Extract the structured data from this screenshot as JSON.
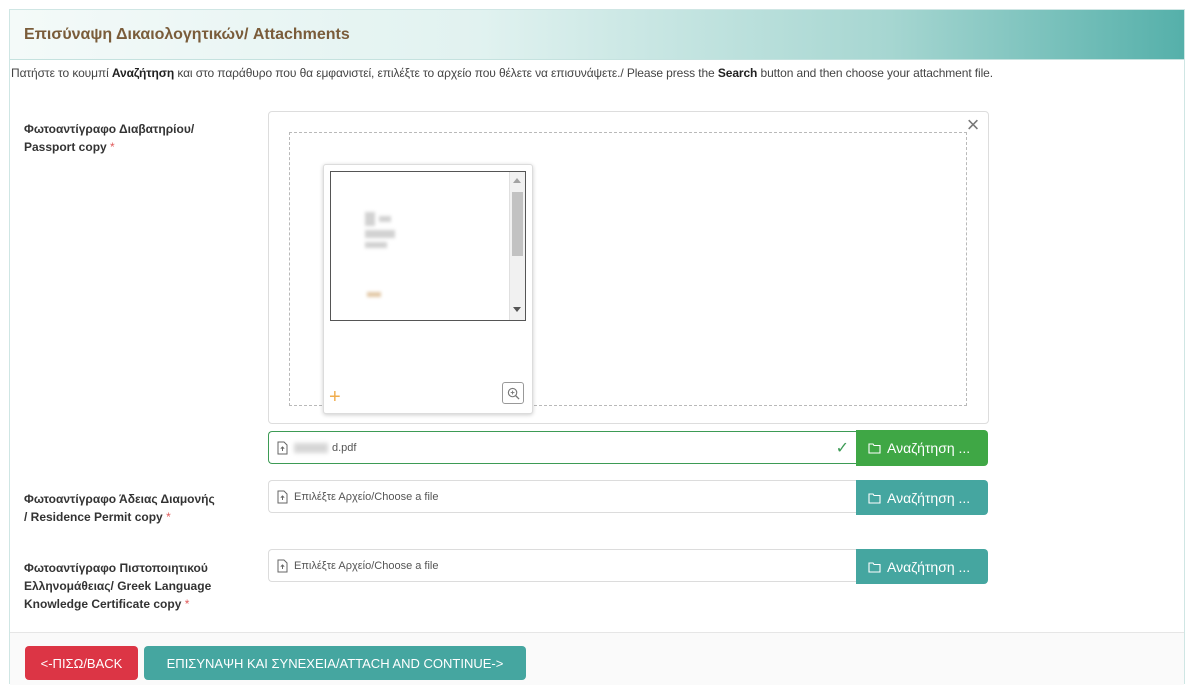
{
  "panel": {
    "title": "Επισύναψη Δικαιολογητικών/ Attachments"
  },
  "instructions": {
    "part1": "Πατήστε το κουμπί ",
    "bold1": "Αναζήτηση",
    "part2": " και στο παράθυρο που θα εμφανιστεί, επιλέξτε το αρχείο που θέλετε να επισυνάψετε./ Please press the ",
    "bold2": "Search",
    "part3": " button and then choose your attachment file."
  },
  "fields": [
    {
      "label_line1": "Φωτοαντίγραφο Διαβατηρίου/",
      "label_line2": "Passport copy",
      "required_mark": "*",
      "file_value": "d.pdf",
      "search_label": "Αναζήτηση ..."
    },
    {
      "label_line1": "Φωτοαντίγραφο Άδειας Διαμονής",
      "label_line2": "/ Residence Permit copy",
      "required_mark": "*",
      "placeholder": "Επιλέξτε Αρχείο/Choose a file",
      "search_label": "Αναζήτηση ..."
    },
    {
      "label_line1": "Φωτοαντίγραφο Πιστοποιητικού",
      "label_line2": "Ελληνομάθειας/ Greek Language",
      "label_line3": "Knowledge Certificate copy",
      "required_mark": "*",
      "placeholder": "Επιλέξτε Αρχείο/Choose a file",
      "search_label": "Αναζήτηση ..."
    }
  ],
  "preview": {
    "close_glyph": "×",
    "add_glyph": "+"
  },
  "footer": {
    "back_label": "<-ΠΙΣΩ/BACK",
    "continue_label": "ΕΠΙΣΥΝΑΨΗ ΚΑΙ ΣΥΝΕΧΕΙΑ/ATTACH AND CONTINUE->"
  },
  "colors": {
    "success_green": "#3fa745",
    "teal": "#45a6a0",
    "danger_red": "#dc3545",
    "title_brown": "#7a5c3a"
  },
  "icons": {
    "close": "close-icon",
    "add": "plus-icon",
    "zoom": "zoom-in-icon",
    "folder": "folder-open-icon",
    "file": "file-icon",
    "check": "check-icon"
  }
}
